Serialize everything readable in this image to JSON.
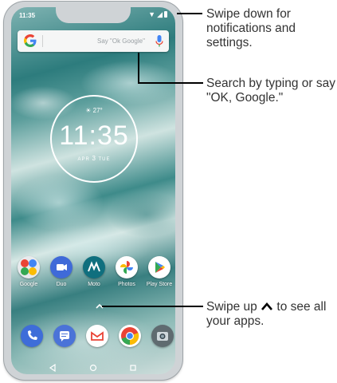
{
  "status_bar": {
    "time": "11:35"
  },
  "search_bar": {
    "hint": "Say \"Ok Google\""
  },
  "clock": {
    "weather": "27°",
    "time": "11:35",
    "date_month": "APR",
    "date_day": "3",
    "date_weekday": "TUE"
  },
  "apps": [
    {
      "label": "Google",
      "icon": "google-folder-icon"
    },
    {
      "label": "Duo",
      "icon": "duo-icon"
    },
    {
      "label": "Moto",
      "icon": "moto-icon"
    },
    {
      "label": "Photos",
      "icon": "photos-icon"
    },
    {
      "label": "Play Store",
      "icon": "play-store-icon"
    }
  ],
  "dock": [
    {
      "icon": "phone-icon"
    },
    {
      "icon": "messages-icon"
    },
    {
      "icon": "gmail-icon"
    },
    {
      "icon": "chrome-icon"
    },
    {
      "icon": "camera-icon"
    }
  ],
  "nav_bar": [
    "back-icon",
    "home-icon",
    "recents-icon"
  ],
  "callouts": {
    "notifications": "Swipe down for notifications and settings.",
    "search": "Search by typing or say \"OK, Google.\"",
    "apps_before": "Swipe up",
    "apps_after": "to see all your apps."
  },
  "colors": {
    "google_blue": "#4285F4",
    "google_red": "#EA4335",
    "google_yellow": "#FBBC05",
    "google_green": "#34A853"
  }
}
